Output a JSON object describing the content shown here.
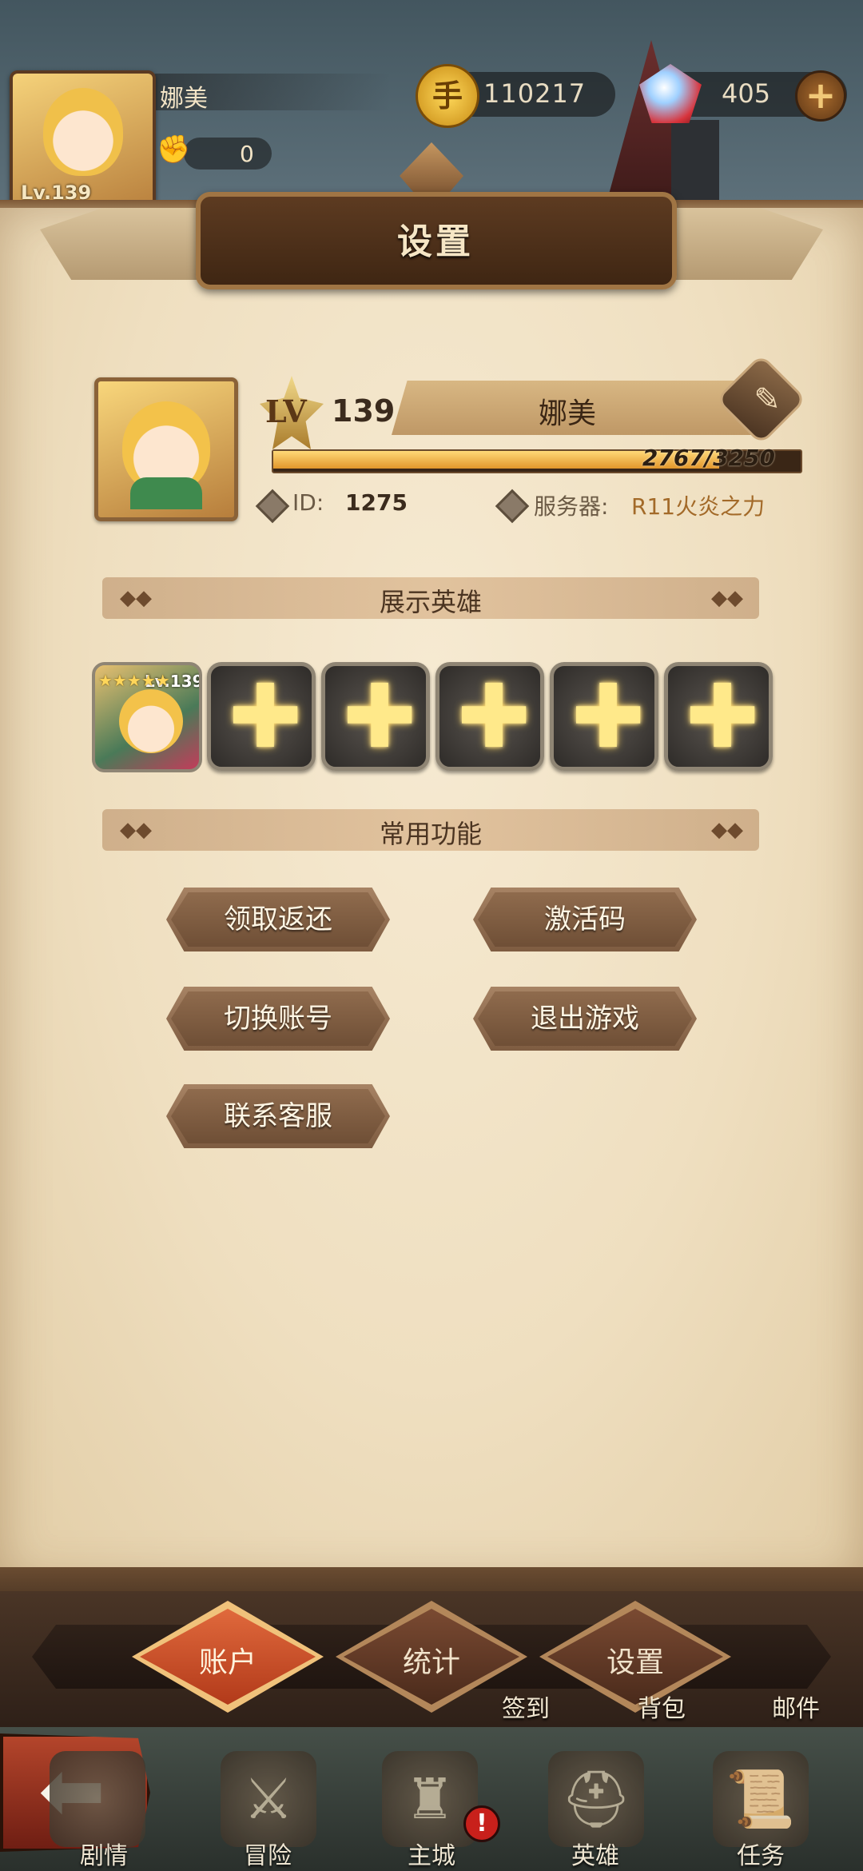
{
  "hud": {
    "name": "娜美",
    "level": "Lv.139",
    "power": "0",
    "gold": "110217",
    "gems": "405",
    "add_label": "+"
  },
  "dialog": {
    "title": "设置"
  },
  "profile": {
    "lv_prefix": "LV",
    "level": "139",
    "name": "娜美",
    "xp_text": "2767/3250",
    "xp_fraction": 0.851,
    "id_label": "ID:",
    "id_value": "1275",
    "server_label": "服务器:",
    "server_value": "R11火炎之力"
  },
  "showcase": {
    "title": "展示英雄",
    "hero_level": "Lv.139",
    "stars": "★★★★★",
    "empty_slot_glyph": "✚"
  },
  "functions": {
    "title": "常用功能",
    "buttons": [
      "领取返还",
      "激活码",
      "切换账号",
      "退出游戏",
      "联系客服"
    ]
  },
  "tabs": [
    "账户",
    "统计",
    "设置"
  ],
  "quick": [
    "签到",
    "背包",
    "邮件"
  ],
  "nav": [
    "剧情",
    "冒险",
    "主城",
    "英雄",
    "任务"
  ],
  "icons": {
    "coin": "coin-icon",
    "gem": "gem-icon",
    "fist": "fist-icon",
    "quill": "quill-icon",
    "back": "back-arrow-icon"
  },
  "colors": {
    "accent_gold": "#e2962b",
    "tab_active": "#c9461f",
    "tab_inactive": "#6a3b27"
  }
}
